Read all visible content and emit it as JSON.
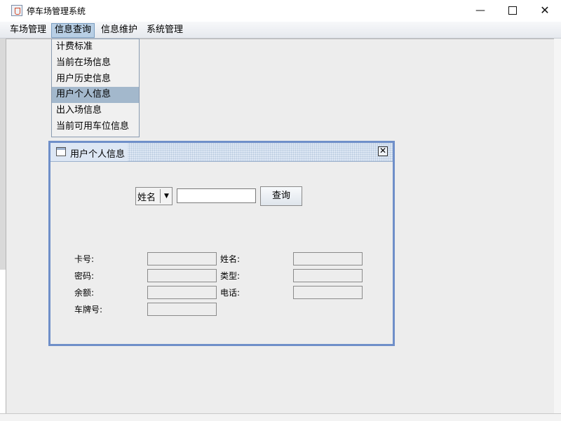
{
  "window": {
    "title": "停车场管理系统",
    "minimize": "—",
    "close": "✕"
  },
  "menubar": [
    "车场管理",
    "信息查询",
    "信息维护",
    "系统管理"
  ],
  "dropdown": {
    "items": [
      "计费标准",
      "当前在场信息",
      "用户历史信息",
      "用户个人信息",
      "出入场信息",
      "当前可用车位信息"
    ],
    "selected_index": 3
  },
  "internal_frame": {
    "title": "用户个人信息",
    "close": "✕",
    "search": {
      "field_options_selected": "姓名",
      "input_value": "",
      "button": "查询"
    },
    "fields": {
      "card_no": {
        "label": "卡号:",
        "value": ""
      },
      "name": {
        "label": "姓名:",
        "value": ""
      },
      "password": {
        "label": "密码:",
        "value": ""
      },
      "type": {
        "label": "类型:",
        "value": ""
      },
      "balance": {
        "label": "余额:",
        "value": ""
      },
      "phone": {
        "label": "电话:",
        "value": ""
      },
      "plate": {
        "label": "车牌号:",
        "value": ""
      }
    }
  },
  "colors": {
    "frame_border": "#6f8fc9",
    "menu_highlight": "#b8cfe5",
    "dropdown_selected": "#a3b8cc"
  }
}
